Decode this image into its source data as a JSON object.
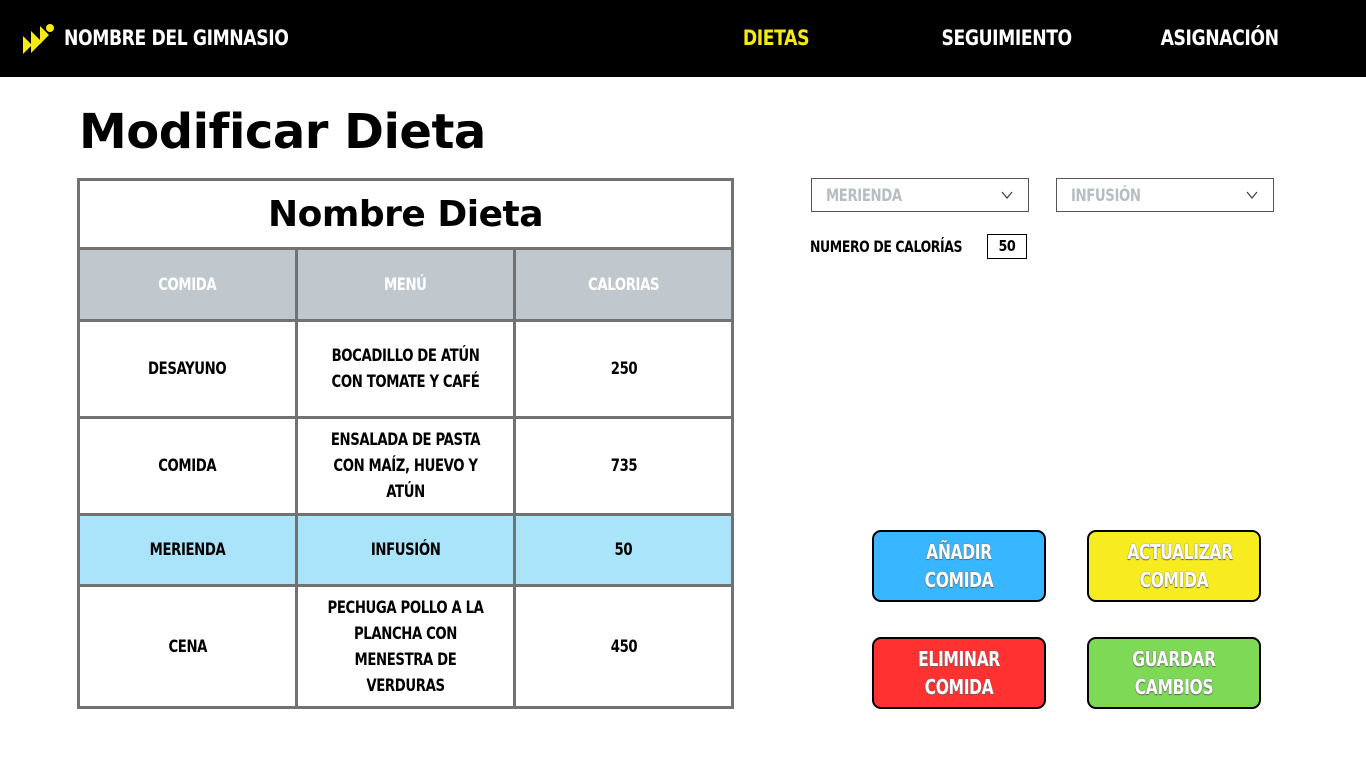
{
  "header": {
    "gym_name": "NOMBRE DEL GIMNASIO",
    "nav": [
      {
        "label": "DIETAS",
        "active": true
      },
      {
        "label": "SEGUIMIENTO",
        "active": false
      },
      {
        "label": "ASIGNACIÓN",
        "active": false
      }
    ],
    "logo_icon": "stairs-logo-icon",
    "active_color": "#f5ea14"
  },
  "page": {
    "title": "Modificar Dieta"
  },
  "diet_table": {
    "name": "Nombre Dieta",
    "columns": [
      "COMIDA",
      "MENÚ",
      "CALORIAS"
    ],
    "rows": [
      {
        "meal": "DESAYUNO",
        "menu": "BOCADILLO DE ATÚN CON TOMATE Y CAFÉ",
        "calories": "250",
        "highlighted": false
      },
      {
        "meal": "COMIDA",
        "menu": "ENSALADA DE PASTA CON MAÍZ, HUEVO Y ATÚN",
        "calories": "735",
        "highlighted": false
      },
      {
        "meal": "MERIENDA",
        "menu": "INFUSIÓN",
        "calories": "50",
        "highlighted": true
      },
      {
        "meal": "CENA",
        "menu": "PECHUGA POLLO A LA PLANCHA CON MENESTRA DE VERDURAS",
        "calories": "450",
        "highlighted": false
      }
    ],
    "header_color": "#c0c8cd",
    "highlight_color": "#a9e4fb"
  },
  "editor": {
    "meal_select": {
      "value": "MERIENDA",
      "icon": "chevron-down-icon"
    },
    "menu_select": {
      "value": "INFUSIÓN",
      "icon": "chevron-down-icon"
    },
    "calories_label": "NUMERO DE CALORÍAS",
    "calories_value": "50"
  },
  "actions": {
    "add": {
      "label": "AÑADIR COMIDA",
      "color": "#38b6ff"
    },
    "update": {
      "label": "ACTUALIZAR COMIDA",
      "color": "#f7ec1f"
    },
    "delete": {
      "label": "ELIMINAR COMIDA",
      "color": "#ff3131"
    },
    "save": {
      "label": "GUARDAR CAMBIOS",
      "color": "#7ed957"
    }
  }
}
